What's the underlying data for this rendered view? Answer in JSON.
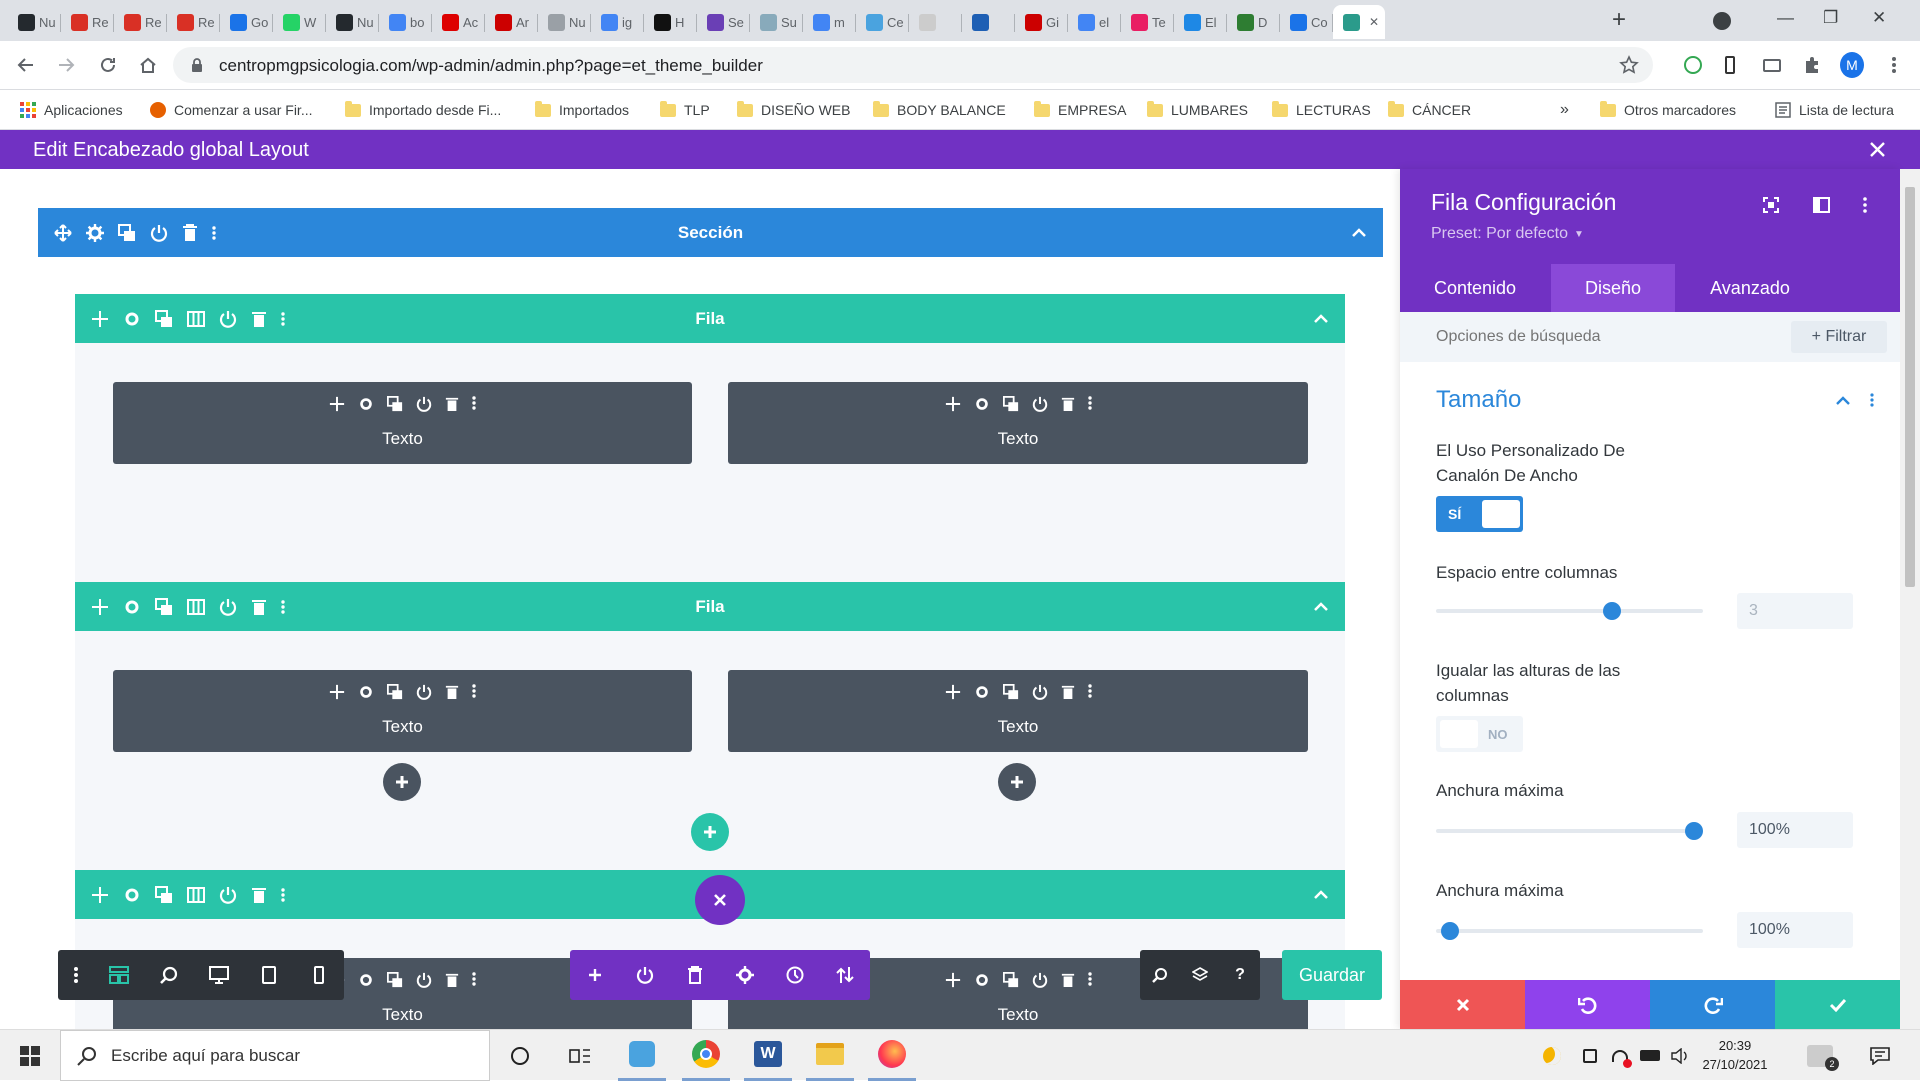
{
  "browser": {
    "tabs": [
      {
        "label": "Nu",
        "icon": "github-icon",
        "color": "#24292e"
      },
      {
        "label": "Re",
        "icon": "gmail-icon",
        "color": "#d93025"
      },
      {
        "label": "Re",
        "icon": "gmail-icon",
        "color": "#d93025"
      },
      {
        "label": "Re",
        "icon": "gmail-icon",
        "color": "#d93025"
      },
      {
        "label": "Go",
        "icon": "calendar-icon",
        "color": "#1a73e8"
      },
      {
        "label": "W",
        "icon": "whatsapp-icon",
        "color": "#25d366"
      },
      {
        "label": "Nu",
        "icon": "github-icon",
        "color": "#24292e"
      },
      {
        "label": "bo",
        "icon": "google-icon",
        "color": "#4285f4"
      },
      {
        "label": "Ac",
        "icon": "w-icon",
        "color": "#d00"
      },
      {
        "label": "Ar",
        "icon": "w-icon",
        "color": "#c00"
      },
      {
        "label": "Nu",
        "icon": "grey-icon",
        "color": "#9aa0a6"
      },
      {
        "label": "ig",
        "icon": "google-icon",
        "color": "#4285f4"
      },
      {
        "label": "H",
        "icon": "app-icon",
        "color": "#111"
      },
      {
        "label": "Se",
        "icon": "app-icon",
        "color": "#6a3fb5"
      },
      {
        "label": "Su",
        "icon": "app-icon",
        "color": "#8ab"
      },
      {
        "label": "m",
        "icon": "google-icon",
        "color": "#4285f4"
      },
      {
        "label": "Ce",
        "icon": "app-icon",
        "color": "#4aa3df"
      },
      {
        "label": "",
        "icon": "grey-icon",
        "color": "#ccc"
      },
      {
        "label": "",
        "icon": "app-icon",
        "color": "#1e5fb4"
      },
      {
        "label": "Gi",
        "icon": "app-icon",
        "color": "#c00"
      },
      {
        "label": "el",
        "icon": "google-icon",
        "color": "#4285f4"
      },
      {
        "label": "Te",
        "icon": "app-icon",
        "color": "#e91e63"
      },
      {
        "label": "El",
        "icon": "app-icon",
        "color": "#1e88e5"
      },
      {
        "label": "D",
        "icon": "app-icon",
        "color": "#2e7d32"
      },
      {
        "label": "Co",
        "icon": "gear-icon",
        "color": "#1a73e8"
      },
      {
        "label": "",
        "icon": "divi-icon",
        "color": "#2b9b8b"
      }
    ],
    "url": "centropmgpsicologia.com/wp-admin/admin.php?page=et_theme_builder",
    "profile_initial": "M",
    "bookmarks": [
      "Aplicaciones",
      "Comenzar a usar Fir...",
      "Importado desde Fi...",
      "Importados",
      "TLP",
      "DISEÑO WEB",
      "BODY BALANCE",
      "EMPRESA",
      "LUMBARES",
      "LECTURAS",
      "CÁNCER",
      "Otros marcadores",
      "Lista de lectura"
    ]
  },
  "builder": {
    "title": "Edit Encabezado global Layout",
    "section_label": "Sección",
    "row_label": "Fila",
    "module_label": "Texto",
    "save_label": "Guardar"
  },
  "panel": {
    "title": "Fila Configuración",
    "preset": "Preset: Por defecto",
    "tabs": [
      "Contenido",
      "Diseño",
      "Avanzado"
    ],
    "search_placeholder": "Opciones de búsqueda",
    "filter_label": "+ Filtrar",
    "group_title": "Tamaño",
    "opt_gutter": "El Uso Personalizado De Canalón De Ancho",
    "toggle_yes": "SÍ",
    "opt_spacing": "Espacio entre columnas",
    "spacing_value": "3",
    "spacing_level": 0.67,
    "opt_equalize": "Igualar las alturas de las columnas",
    "toggle_no": "NO",
    "opt_maxwidth": "Anchura máxima",
    "maxwidth_value": "100%",
    "maxwidth_level": 1.0,
    "opt_maxwidth2": "Anchura máxima",
    "maxwidth2_value": "100%",
    "maxwidth2_level": 0.02
  },
  "taskbar": {
    "search_placeholder": "Escribe aquí para buscar",
    "time": "20:39",
    "date": "27/10/2021"
  },
  "colors": {
    "divi_purple": "#7131c3",
    "section_blue": "#2b87da",
    "row_green": "#29c4a9",
    "module_dark": "#4a5460",
    "cancel_red": "#ef5555",
    "undo_purple": "#8f42ec",
    "redo_blue": "#2b87da",
    "save_green": "#29c4a9"
  }
}
